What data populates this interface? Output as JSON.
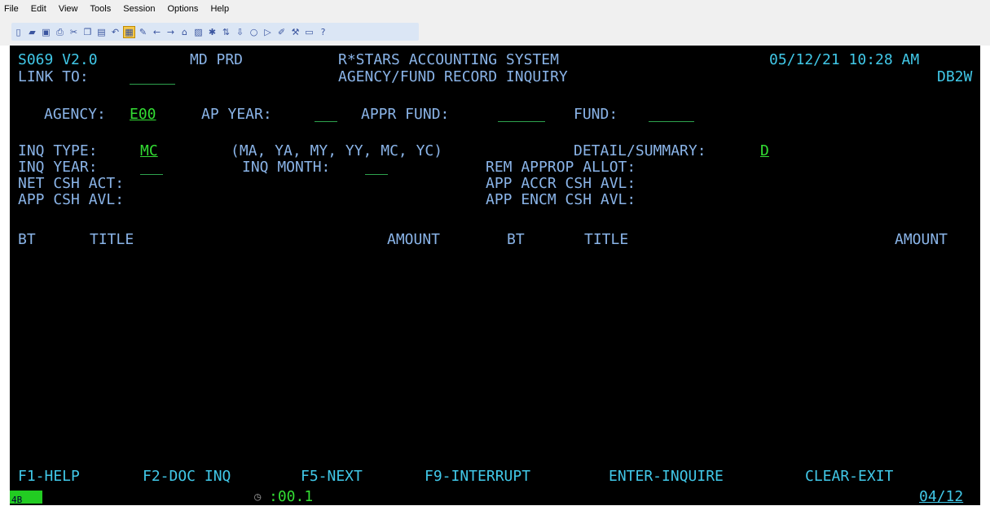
{
  "menu": [
    "File",
    "Edit",
    "View",
    "Tools",
    "Session",
    "Options",
    "Help"
  ],
  "toolbar_icons": [
    "new-doc-icon",
    "open-folder-icon",
    "save-icon",
    "print-icon",
    "cut-icon",
    "copy-icon",
    "paste-icon",
    "undo-icon",
    "screen-icon",
    "marker-icon",
    "back-arrow-icon",
    "forward-arrow-icon",
    "home-icon",
    "macro-icon",
    "settings-icon",
    "transfer-icon",
    "receive-icon",
    "record-icon",
    "play-icon",
    "edit-icon",
    "tool-icon",
    "window-icon",
    "help-icon"
  ],
  "header": {
    "screen_id": "S069 V2.0",
    "env": "MD PRD",
    "system_title": "R*STARS ACCOUNTING SYSTEM",
    "date_time": "05/12/21 10:28 AM",
    "link_to_label": "LINK TO:",
    "screen_title": "AGENCY/FUND RECORD INQUIRY",
    "region": "DB2W"
  },
  "keys": {
    "agency_label": "AGENCY:",
    "agency_value": "E00",
    "ap_year_label": "AP YEAR:",
    "appr_fund_label": "APPR FUND:",
    "fund_label": "FUND:"
  },
  "inquiry": {
    "inq_type_label": "INQ TYPE:",
    "inq_type_value": "MC",
    "inq_type_options": "(MA, YA, MY, YY, MC, YC)",
    "detail_summary_label": "DETAIL/SUMMARY:",
    "detail_summary_value": "D",
    "inq_year_label": "INQ YEAR:",
    "inq_month_label": "INQ MONTH:",
    "rem_approp_allot_label": "REM APPROP ALLOT:",
    "net_csh_act_label": "NET CSH ACT:",
    "app_accr_csh_avl_label": "APP ACCR CSH AVL:",
    "app_csh_avl_label": "APP CSH AVL:",
    "app_encm_csh_avl_label": "APP ENCM CSH AVL:"
  },
  "table_headers": {
    "bt1": "BT",
    "title1": "TITLE",
    "amount1": "AMOUNT",
    "bt2": "BT",
    "title2": "TITLE",
    "amount2": "AMOUNT"
  },
  "function_keys": [
    "F1-HELP",
    "F2-DOC INQ",
    "F5-NEXT",
    "F9-INTERRUPT",
    "ENTER-INQUIRE",
    "CLEAR-EXIT"
  ],
  "status_bar": {
    "indicator": "4B",
    "timer": ":00.1",
    "cursor_pos": "04/12"
  }
}
